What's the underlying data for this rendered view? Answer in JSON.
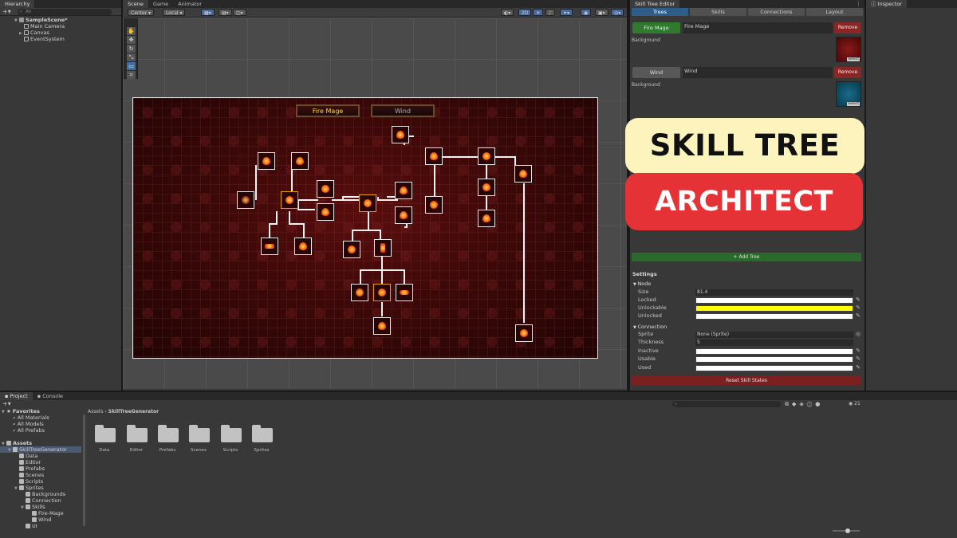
{
  "hierarchy": {
    "tab": "Hierarchy",
    "search_placeholder": "All",
    "items": [
      "SampleScene*",
      "Main Camera",
      "Canvas",
      "EventSystem"
    ]
  },
  "scene": {
    "tabs": [
      "Scene",
      "Game",
      "Animator"
    ],
    "pivot": "Center",
    "space": "Local",
    "mode_2d": "2D",
    "tree_tabs": [
      "Fire Mage",
      "Wind"
    ]
  },
  "editor": {
    "window_title": "Skill Tree Editor",
    "inspector_tab": "Inspector",
    "tabs": [
      "Trees",
      "Skills",
      "Connections",
      "Layout"
    ],
    "trees": [
      {
        "button": "Fire Mage",
        "name": "Fire Mage",
        "bg_label": "Background",
        "remove": "Remove",
        "select": "Select",
        "bg_color": "#6a0a0a"
      },
      {
        "button": "Wind",
        "name": "Wind",
        "bg_label": "Background",
        "remove": "Remove",
        "select": "Select",
        "bg_color": "#0a4a6a"
      }
    ],
    "add_tree": "+ Add Tree",
    "settings": "Settings",
    "node_section": "Node",
    "size_label": "Size",
    "size_value": "81.4",
    "locked_label": "Locked",
    "unlockable_label": "Unlockable",
    "unlocked_label": "Unlocked",
    "connection_section": "Connection",
    "sprite_label": "Sprite",
    "sprite_value": "None (Sprite)",
    "thickness_label": "Thickness",
    "thickness_value": "5",
    "inactive_label": "Inactive",
    "usable_label": "Usable",
    "used_label": "Used",
    "reset": "Reset Skill States",
    "colors": {
      "locked": "#ffffff",
      "unlockable": "#ffff00",
      "unlocked": "#ffffff",
      "inactive": "#ffffff",
      "usable": "#ffffff",
      "used": "#ffffff"
    }
  },
  "banner": {
    "line1": "SKILL TREE",
    "line2": "ARCHITECT"
  },
  "project": {
    "tabs": [
      "Project",
      "Console"
    ],
    "favorites": "Favorites",
    "fav_items": [
      "All Materials",
      "All Models",
      "All Prefabs"
    ],
    "assets": "Assets",
    "tree": [
      "SkillTreeGenerator",
      "Data",
      "Editor",
      "Prefabs",
      "Scenes",
      "Scripts",
      "Sprites",
      "Backgrounds",
      "Connection",
      "Skills",
      "Fire-Mage",
      "Wind",
      "UI"
    ],
    "breadcrumb": [
      "Assets",
      "SkillTreeGenerator"
    ],
    "folders": [
      "Data",
      "Editor",
      "Prefabs",
      "Scenes",
      "Scripts",
      "Sprites"
    ],
    "count": "21"
  }
}
